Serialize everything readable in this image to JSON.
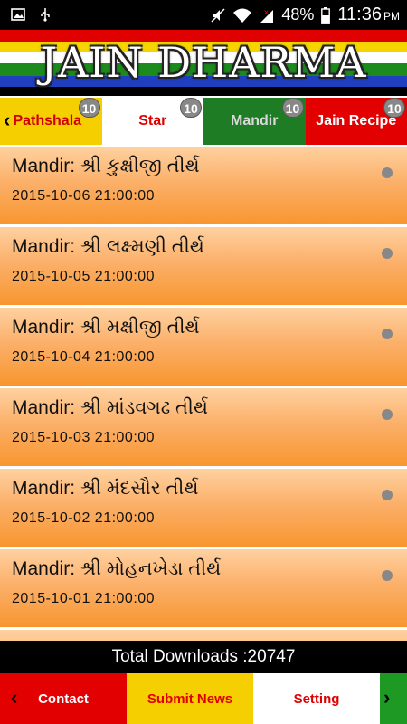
{
  "status_bar": {
    "battery_percent": "48%",
    "time": "11:36",
    "ampm": "PM",
    "icons": [
      "image-icon",
      "usb-icon",
      "mute-icon",
      "wifi-icon",
      "signal-icon",
      "battery-icon"
    ]
  },
  "banner": {
    "title": "JAIN DHARMA"
  },
  "tabs": [
    {
      "label": "Pathshala",
      "badge": "10"
    },
    {
      "label": "Star",
      "badge": "10"
    },
    {
      "label": "Mandir",
      "badge": "10"
    },
    {
      "label": "Jain Recipe",
      "badge": "10"
    }
  ],
  "list": {
    "items": [
      {
        "title": "Mandir: શ્રી કુક્ષીજી તીર્થ",
        "date": "2015-10-06 21:00:00"
      },
      {
        "title": "Mandir: શ્રી લક્ષ્મણી તીર્થ",
        "date": "2015-10-05 21:00:00"
      },
      {
        "title": "Mandir: શ્રી મક્ષીજી તીર્થ",
        "date": "2015-10-04 21:00:00"
      },
      {
        "title": "Mandir: શ્રી માંડવગઢ તીર્થ",
        "date": "2015-10-03 21:00:00"
      },
      {
        "title": "Mandir: શ્રી મંદસૌર તીર્થ",
        "date": "2015-10-02 21:00:00"
      },
      {
        "title": "Mandir: શ્રી મોહનખેડા તીર્થ",
        "date": "2015-10-01 21:00:00"
      }
    ]
  },
  "footer": {
    "total_downloads": "Total Downloads :20747"
  },
  "bottom_nav": {
    "contact": "Contact",
    "submit_news": "Submit News",
    "setting": "Setting"
  },
  "colors": {
    "red": "#e20000",
    "yellow": "#f6cf00",
    "green": "#1e7d24",
    "orange": "#f8962f"
  }
}
